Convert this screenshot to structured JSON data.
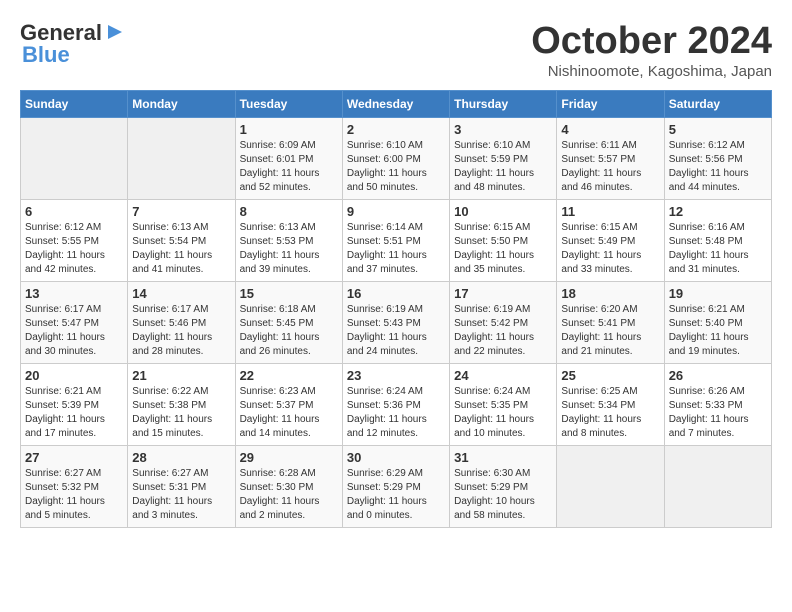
{
  "logo": {
    "general": "General",
    "blue": "Blue",
    "arrow_color": "#4a90d9"
  },
  "header": {
    "month": "October 2024",
    "location": "Nishinoomote, Kagoshima, Japan"
  },
  "weekdays": [
    "Sunday",
    "Monday",
    "Tuesday",
    "Wednesday",
    "Thursday",
    "Friday",
    "Saturday"
  ],
  "weeks": [
    [
      {
        "day": "",
        "info": ""
      },
      {
        "day": "",
        "info": ""
      },
      {
        "day": "1",
        "info": "Sunrise: 6:09 AM\nSunset: 6:01 PM\nDaylight: 11 hours and 52 minutes."
      },
      {
        "day": "2",
        "info": "Sunrise: 6:10 AM\nSunset: 6:00 PM\nDaylight: 11 hours and 50 minutes."
      },
      {
        "day": "3",
        "info": "Sunrise: 6:10 AM\nSunset: 5:59 PM\nDaylight: 11 hours and 48 minutes."
      },
      {
        "day": "4",
        "info": "Sunrise: 6:11 AM\nSunset: 5:57 PM\nDaylight: 11 hours and 46 minutes."
      },
      {
        "day": "5",
        "info": "Sunrise: 6:12 AM\nSunset: 5:56 PM\nDaylight: 11 hours and 44 minutes."
      }
    ],
    [
      {
        "day": "6",
        "info": "Sunrise: 6:12 AM\nSunset: 5:55 PM\nDaylight: 11 hours and 42 minutes."
      },
      {
        "day": "7",
        "info": "Sunrise: 6:13 AM\nSunset: 5:54 PM\nDaylight: 11 hours and 41 minutes."
      },
      {
        "day": "8",
        "info": "Sunrise: 6:13 AM\nSunset: 5:53 PM\nDaylight: 11 hours and 39 minutes."
      },
      {
        "day": "9",
        "info": "Sunrise: 6:14 AM\nSunset: 5:51 PM\nDaylight: 11 hours and 37 minutes."
      },
      {
        "day": "10",
        "info": "Sunrise: 6:15 AM\nSunset: 5:50 PM\nDaylight: 11 hours and 35 minutes."
      },
      {
        "day": "11",
        "info": "Sunrise: 6:15 AM\nSunset: 5:49 PM\nDaylight: 11 hours and 33 minutes."
      },
      {
        "day": "12",
        "info": "Sunrise: 6:16 AM\nSunset: 5:48 PM\nDaylight: 11 hours and 31 minutes."
      }
    ],
    [
      {
        "day": "13",
        "info": "Sunrise: 6:17 AM\nSunset: 5:47 PM\nDaylight: 11 hours and 30 minutes."
      },
      {
        "day": "14",
        "info": "Sunrise: 6:17 AM\nSunset: 5:46 PM\nDaylight: 11 hours and 28 minutes."
      },
      {
        "day": "15",
        "info": "Sunrise: 6:18 AM\nSunset: 5:45 PM\nDaylight: 11 hours and 26 minutes."
      },
      {
        "day": "16",
        "info": "Sunrise: 6:19 AM\nSunset: 5:43 PM\nDaylight: 11 hours and 24 minutes."
      },
      {
        "day": "17",
        "info": "Sunrise: 6:19 AM\nSunset: 5:42 PM\nDaylight: 11 hours and 22 minutes."
      },
      {
        "day": "18",
        "info": "Sunrise: 6:20 AM\nSunset: 5:41 PM\nDaylight: 11 hours and 21 minutes."
      },
      {
        "day": "19",
        "info": "Sunrise: 6:21 AM\nSunset: 5:40 PM\nDaylight: 11 hours and 19 minutes."
      }
    ],
    [
      {
        "day": "20",
        "info": "Sunrise: 6:21 AM\nSunset: 5:39 PM\nDaylight: 11 hours and 17 minutes."
      },
      {
        "day": "21",
        "info": "Sunrise: 6:22 AM\nSunset: 5:38 PM\nDaylight: 11 hours and 15 minutes."
      },
      {
        "day": "22",
        "info": "Sunrise: 6:23 AM\nSunset: 5:37 PM\nDaylight: 11 hours and 14 minutes."
      },
      {
        "day": "23",
        "info": "Sunrise: 6:24 AM\nSunset: 5:36 PM\nDaylight: 11 hours and 12 minutes."
      },
      {
        "day": "24",
        "info": "Sunrise: 6:24 AM\nSunset: 5:35 PM\nDaylight: 11 hours and 10 minutes."
      },
      {
        "day": "25",
        "info": "Sunrise: 6:25 AM\nSunset: 5:34 PM\nDaylight: 11 hours and 8 minutes."
      },
      {
        "day": "26",
        "info": "Sunrise: 6:26 AM\nSunset: 5:33 PM\nDaylight: 11 hours and 7 minutes."
      }
    ],
    [
      {
        "day": "27",
        "info": "Sunrise: 6:27 AM\nSunset: 5:32 PM\nDaylight: 11 hours and 5 minutes."
      },
      {
        "day": "28",
        "info": "Sunrise: 6:27 AM\nSunset: 5:31 PM\nDaylight: 11 hours and 3 minutes."
      },
      {
        "day": "29",
        "info": "Sunrise: 6:28 AM\nSunset: 5:30 PM\nDaylight: 11 hours and 2 minutes."
      },
      {
        "day": "30",
        "info": "Sunrise: 6:29 AM\nSunset: 5:29 PM\nDaylight: 11 hours and 0 minutes."
      },
      {
        "day": "31",
        "info": "Sunrise: 6:30 AM\nSunset: 5:29 PM\nDaylight: 10 hours and 58 minutes."
      },
      {
        "day": "",
        "info": ""
      },
      {
        "day": "",
        "info": ""
      }
    ]
  ]
}
